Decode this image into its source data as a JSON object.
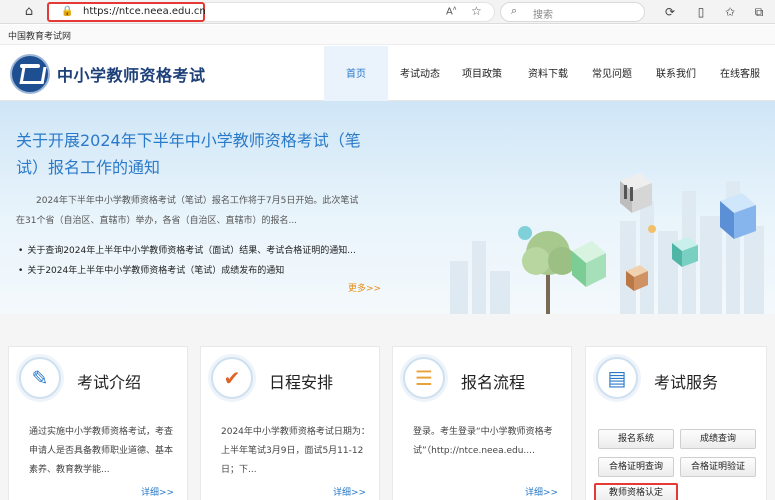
{
  "browser": {
    "url": "https://ntce.neea.edu.cn",
    "search_placeholder": "搜索",
    "favorites": [
      "中国教育考试网"
    ]
  },
  "site": {
    "title": "中小学教师资格考试",
    "nav": [
      "首页",
      "考试动态",
      "项目政策",
      "资料下载",
      "常见问题",
      "联系我们",
      "在线客服"
    ],
    "active_nav": "首页"
  },
  "hero": {
    "title": "关于开展2024年下半年中小学教师资格考试（笔试）报名工作的通知",
    "summary": "2024年下半年中小学教师资格考试（笔试）报名工作将于7月5日开始。此次笔试在31个省（自治区、直辖市）举办，各省（自治区、直辖市）的报名...",
    "links": [
      "关于查询2024年上半年中小学教师资格考试（面试）结果、考试合格证明的通知...",
      "关于2024年上半年中小学教师资格考试（笔试）成绩发布的通知"
    ],
    "more": "更多>>"
  },
  "cards": [
    {
      "title": "考试介绍",
      "icon": "document-edit-icon",
      "desc": "通过实施中小学教师资格考试，考查申请人是否具备教师职业道德、基本素养、教育教学能...",
      "detail": "详细>>"
    },
    {
      "title": "日程安排",
      "icon": "checkmark-icon",
      "desc": "2024年中小学教师资格考试日期为：上半年笔试3月9日，面试5月11-12日；下...",
      "detail": "详细>>"
    },
    {
      "title": "报名流程",
      "icon": "list-icon",
      "desc": "登录。考生登录“中小学教师资格考试”（http://ntce.neea.edu....",
      "detail": "详细>>"
    },
    {
      "title": "考试服务",
      "icon": "id-card-icon",
      "buttons": [
        "报名系统",
        "成绩查询",
        "合格证明查询",
        "合格证明验证",
        "教师资格认定"
      ]
    }
  ],
  "colors": {
    "accent": "#2a7ac9",
    "highlight": "#e53935",
    "brand": "#1d3f7a"
  }
}
